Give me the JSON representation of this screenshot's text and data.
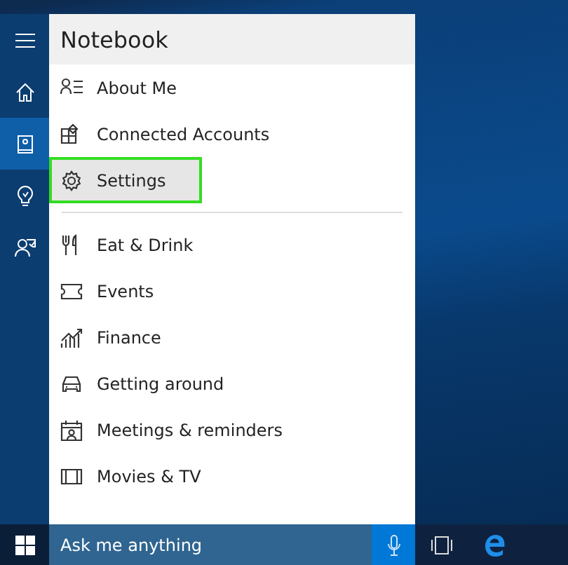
{
  "rail": {
    "items": [
      {
        "selected": false
      },
      {
        "selected": true
      },
      {
        "selected": false
      },
      {
        "selected": false
      }
    ]
  },
  "notebook": {
    "title": "Notebook",
    "top_items": [
      {
        "label": "About Me",
        "selected": false
      },
      {
        "label": "Connected Accounts",
        "selected": false
      },
      {
        "label": "Settings",
        "selected": true
      }
    ],
    "categories": [
      {
        "label": "Eat & Drink"
      },
      {
        "label": "Events"
      },
      {
        "label": "Finance"
      },
      {
        "label": "Getting around"
      },
      {
        "label": "Meetings & reminders"
      },
      {
        "label": "Movies & TV"
      }
    ]
  },
  "taskbar": {
    "search": {
      "placeholder": "Ask me anything"
    }
  }
}
